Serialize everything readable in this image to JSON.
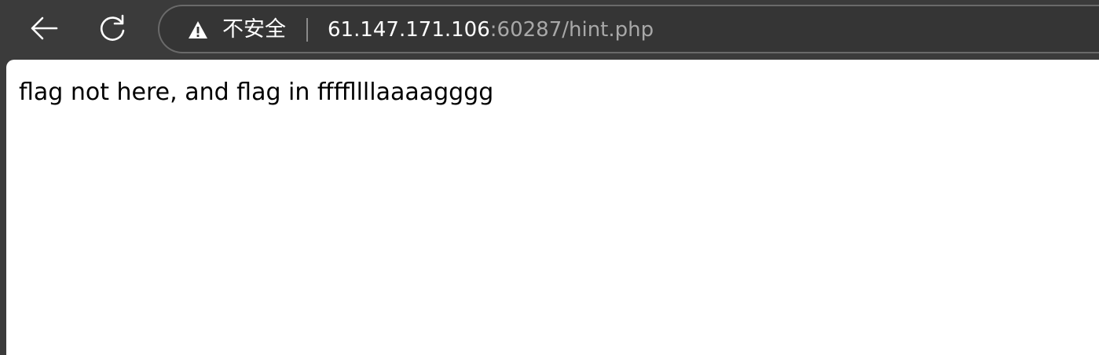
{
  "browser": {
    "back_icon": "arrow-left-icon",
    "reload_icon": "reload-icon",
    "security_icon": "warning-triangle-icon",
    "security_label": "不安全",
    "url_host": "61.147.171.106",
    "url_rest": ":60287/hint.php"
  },
  "page": {
    "body_text": "flag not here, and flag in ffffllllaaaagggg"
  },
  "colors": {
    "toolbar": "#3b3b3b",
    "url_dim": "#a8a8a8",
    "page_bg": "#ffffff"
  }
}
